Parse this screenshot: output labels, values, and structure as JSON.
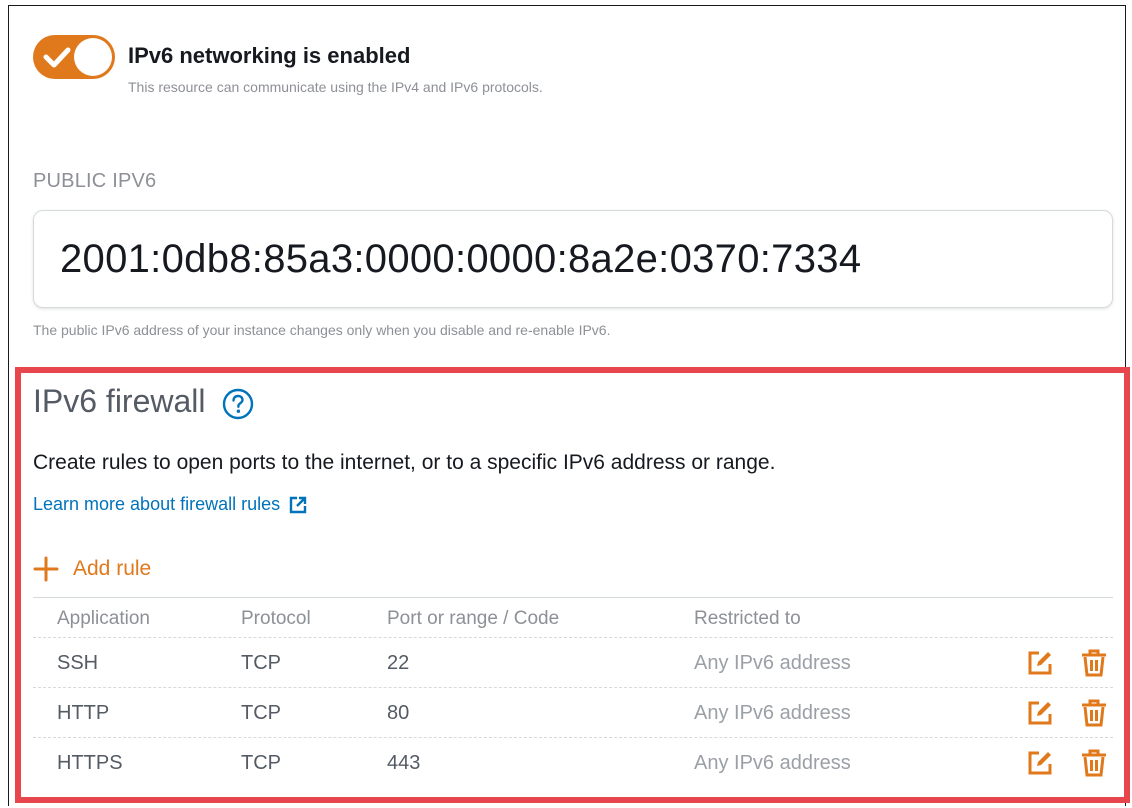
{
  "ipv6_toggle": {
    "title": "IPv6 networking is enabled",
    "description": "This resource can communicate using the IPv4 and IPv6 protocols.",
    "enabled": true,
    "color": "#e0791c"
  },
  "public_ipv6": {
    "label": "PUBLIC IPV6",
    "value": "2001:0db8:85a3:0000:0000:8a2e:0370:7334",
    "help": "The public IPv6 address of your instance changes only when you disable and re-enable IPv6."
  },
  "firewall": {
    "title": "IPv6 firewall",
    "help_icon": "question-circle-icon",
    "description": "Create rules to open ports to the internet, or to a specific IPv6 address or range.",
    "learn_more": "Learn more about firewall rules",
    "add_rule": "Add rule",
    "columns": [
      "Application",
      "Protocol",
      "Port or range / Code",
      "Restricted to"
    ],
    "rules": [
      {
        "application": "SSH",
        "protocol": "TCP",
        "port": "22",
        "restricted_to": "Any IPv6 address"
      },
      {
        "application": "HTTP",
        "protocol": "TCP",
        "port": "80",
        "restricted_to": "Any IPv6 address"
      },
      {
        "application": "HTTPS",
        "protocol": "TCP",
        "port": "443",
        "restricted_to": "Any IPv6 address"
      }
    ],
    "highlight_color": "#e8464d",
    "link_color": "#0073bb",
    "accent_color": "#e0791c"
  }
}
